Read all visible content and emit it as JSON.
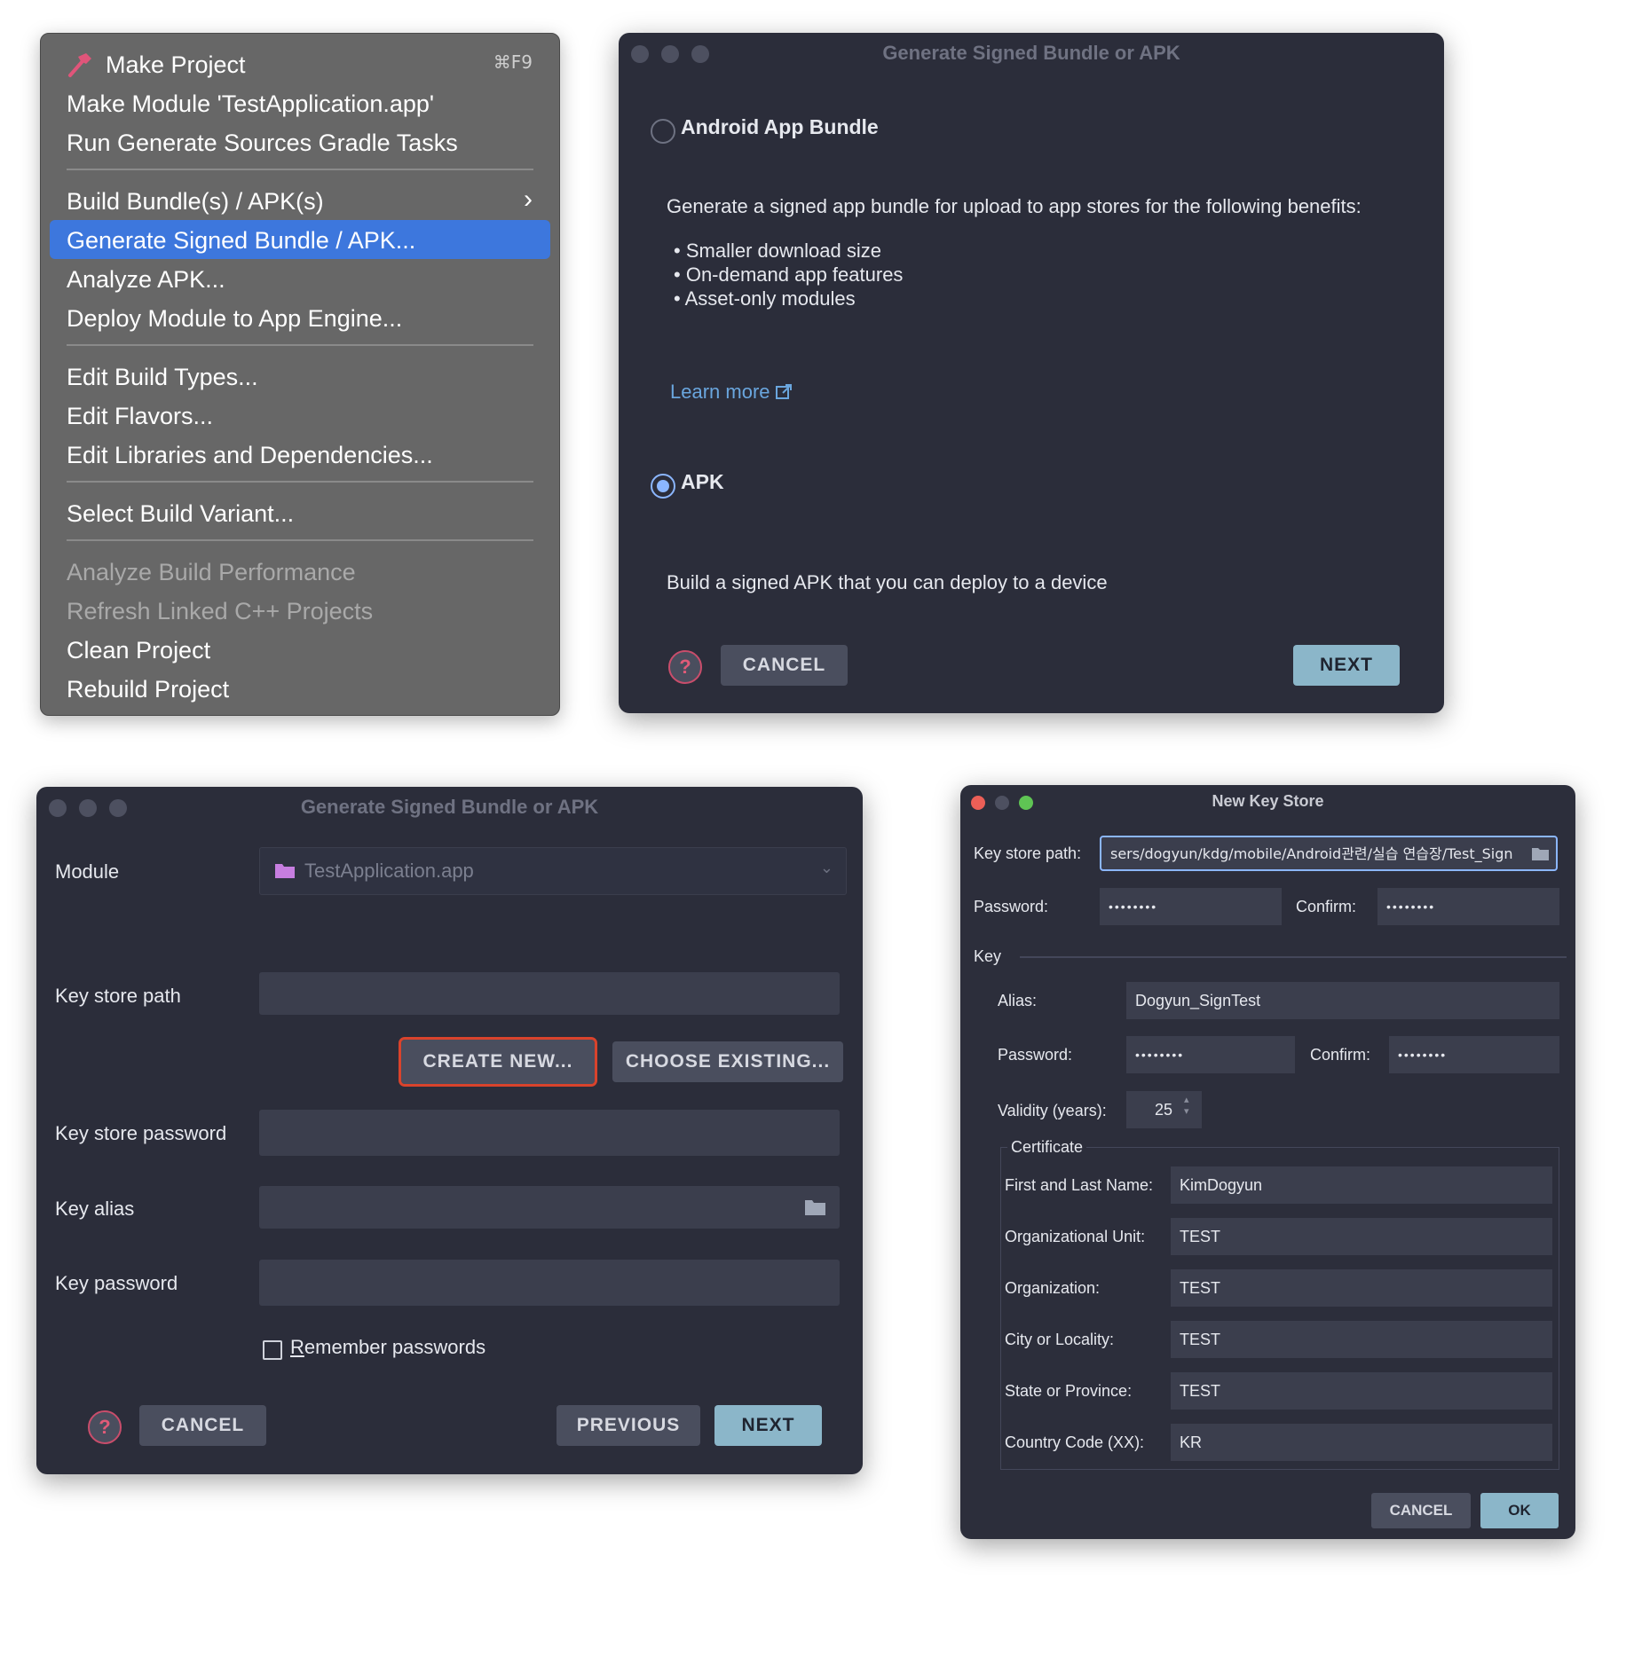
{
  "menu": {
    "items": [
      {
        "label": "Make Project",
        "shortcut": "⌘F9",
        "icon": "hammer-icon"
      },
      {
        "label": "Make Module 'TestApplication.app'"
      },
      {
        "label": "Run Generate Sources Gradle Tasks"
      },
      {
        "label": "Build Bundle(s) / APK(s)",
        "icon": "chevron-right-icon"
      },
      {
        "label": "Generate Signed Bundle / APK..."
      },
      {
        "label": "Analyze APK..."
      },
      {
        "label": "Deploy Module to App Engine..."
      },
      {
        "label": "Edit Build Types..."
      },
      {
        "label": "Edit Flavors..."
      },
      {
        "label": "Edit Libraries and Dependencies..."
      },
      {
        "label": "Select Build Variant..."
      },
      {
        "label": "Analyze Build Performance"
      },
      {
        "label": "Refresh Linked C++ Projects"
      },
      {
        "label": "Clean Project"
      },
      {
        "label": "Rebuild Project"
      }
    ],
    "highlight_color": "#3d77dd"
  },
  "dialog1": {
    "title": "Generate Signed Bundle or APK",
    "bundle_label": "Android App Bundle",
    "bundle_description": "Generate a signed app bundle for upload to app stores for the following benefits:",
    "benefits": [
      "Smaller download size",
      "On-demand app features",
      "Asset-only modules"
    ],
    "learn_more": "Learn more",
    "apk_label": "APK",
    "apk_description": "Build a signed APK that you can deploy to a device",
    "selected": "APK",
    "cancel": "CANCEL",
    "next": "NEXT"
  },
  "dialog2": {
    "title": "Generate Signed Bundle or APK",
    "module_label": "Module",
    "module_value": "TestApplication.app",
    "key_store_path_label": "Key store path",
    "create_new": "CREATE NEW...",
    "choose_existing": "CHOOSE EXISTING...",
    "key_store_password_label": "Key store password",
    "key_alias_label": "Key alias",
    "key_password_label": "Key password",
    "remember_prefix": "R",
    "remember_rest": "emember passwords",
    "remember_checked": false,
    "cancel": "CANCEL",
    "previous": "PREVIOUS",
    "next": "NEXT",
    "highlight_color": "#d9432c"
  },
  "dialog3": {
    "title": "New Key Store",
    "key_store_path_label": "Key store path:",
    "key_store_path_value": "sers/dogyun/kdg/mobile/Android관련/실습 연습장/Test_Sign",
    "password_label": "Password:",
    "password_value": "••••••••",
    "confirm_label": "Confirm:",
    "confirm_value": "••••••••",
    "key_section": "Key",
    "alias_label": "Alias:",
    "alias_value": "Dogyun_SignTest",
    "key_password_label": "Password:",
    "key_password_value": "••••••••",
    "key_confirm_label": "Confirm:",
    "key_confirm_value": "••••••••",
    "validity_label": "Validity (years):",
    "validity_value": "25",
    "certificate_label": "Certificate",
    "cert_fields": [
      {
        "label": "First and Last Name:",
        "value": "KimDogyun"
      },
      {
        "label": "Organizational Unit:",
        "value": "TEST"
      },
      {
        "label": "Organization:",
        "value": "TEST"
      },
      {
        "label": "City or Locality:",
        "value": "TEST"
      },
      {
        "label": "State or Province:",
        "value": "TEST"
      },
      {
        "label": "Country Code (XX):",
        "value": "KR"
      }
    ],
    "cancel": "CANCEL",
    "ok": "OK"
  }
}
